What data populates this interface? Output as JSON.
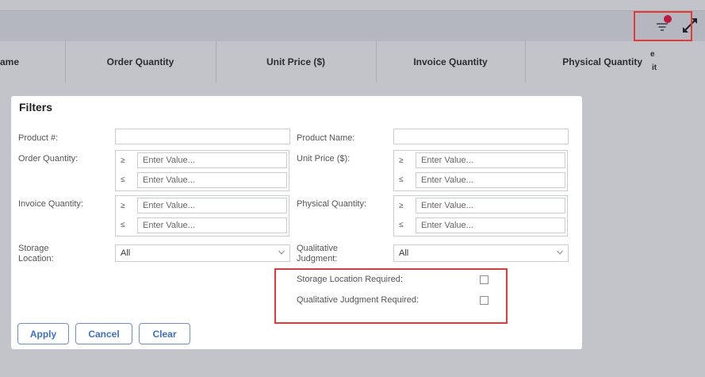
{
  "toolbar": {
    "filter_icon": "filter-icon",
    "expand_icon": "expand-icon",
    "accent": "#c0183d",
    "highlight": "#e53935"
  },
  "table": {
    "headers": [
      "ame",
      "Order Quantity",
      "Unit Price ($)",
      "Invoice Quantity",
      "Physical Quantity",
      "e",
      "it"
    ]
  },
  "filters": {
    "title": "Filters",
    "product_no": {
      "label": "Product #:",
      "value": ""
    },
    "product_name": {
      "label": "Product Name:",
      "value": ""
    },
    "order_quantity": {
      "label": "Order Quantity:",
      "op_ge": "≥",
      "op_le": "≤",
      "placeholder_ge": "Enter Value...",
      "placeholder_le": "Enter Value..."
    },
    "unit_price": {
      "label": "Unit Price ($):",
      "op_ge": "≥",
      "op_le": "≤",
      "placeholder_ge": "Enter Value...",
      "placeholder_le": "Enter Value..."
    },
    "invoice_quantity": {
      "label": "Invoice Quantity:",
      "op_ge": "≥",
      "op_le": "≤",
      "placeholder_ge": "Enter Value...",
      "placeholder_le": "Enter Value..."
    },
    "physical_quantity": {
      "label": "Physical Quantity:",
      "op_ge": "≥",
      "op_le": "≤",
      "placeholder_ge": "Enter Value...",
      "placeholder_le": "Enter Value..."
    },
    "storage_location": {
      "label_line1": "Storage",
      "label_line2": "Location:",
      "value": "All"
    },
    "qualitative_judgment": {
      "label_line1": "Qualitative",
      "label_line2": "Judgment:",
      "value": "All"
    },
    "storage_location_required": {
      "label": "Storage Location Required:",
      "checked": false
    },
    "qualitative_judgment_required": {
      "label": "Qualitative Judgment Required:",
      "checked": false
    },
    "buttons": {
      "apply": "Apply",
      "cancel": "Cancel",
      "clear": "Clear"
    }
  }
}
